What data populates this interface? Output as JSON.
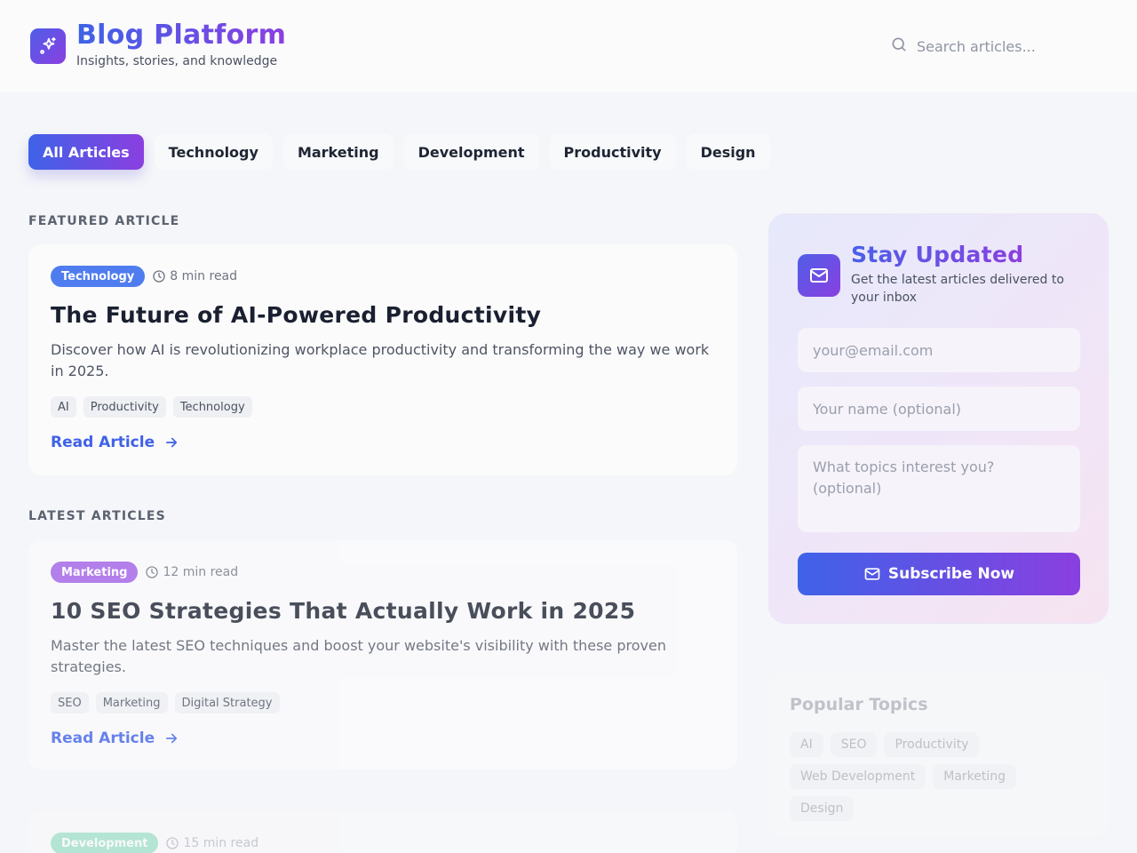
{
  "header": {
    "title": "Blog Platform",
    "subtitle": "Insights, stories, and knowledge",
    "search_placeholder": "Search articles...",
    "logo_icon": "sparkles-icon"
  },
  "tabs": [
    {
      "label": "All Articles",
      "active": true
    },
    {
      "label": "Technology",
      "active": false
    },
    {
      "label": "Marketing",
      "active": false
    },
    {
      "label": "Development",
      "active": false
    },
    {
      "label": "Productivity",
      "active": false
    },
    {
      "label": "Design",
      "active": false
    }
  ],
  "featured": {
    "section_label": "FEATURED ARTICLE",
    "category": "Technology",
    "category_color": "#4f7df0",
    "read_time": "8 min read",
    "title": "The Future of AI-Powered Productivity",
    "description": "Discover how AI is revolutionizing workplace productivity and transforming the way we work in 2025.",
    "tags": [
      "AI",
      "Productivity",
      "Technology"
    ],
    "link_label": "Read Article"
  },
  "latest": {
    "section_label": "LATEST ARTICLES",
    "articles": [
      {
        "category": "Marketing",
        "category_color": "#a15ee6",
        "read_time": "12 min read",
        "title": "10 SEO Strategies That Actually Work in 2025",
        "description": "Master the latest SEO techniques and boost your website's visibility with these proven strategies.",
        "tags": [
          "SEO",
          "Marketing",
          "Digital Strategy"
        ],
        "link_label": "Read Article"
      },
      {
        "category": "Development",
        "category_color": "#3dc48e",
        "read_time": "15 min read"
      }
    ]
  },
  "newsletter": {
    "title": "Stay Updated",
    "subtitle": "Get the latest articles delivered to your inbox",
    "email_placeholder": "your@email.com",
    "name_placeholder": "Your name (optional)",
    "topics_placeholder": "What topics interest you? (optional)",
    "button_label": "Subscribe Now",
    "icon": "mail-icon"
  },
  "popular_topics": {
    "title": "Popular Topics",
    "tags": [
      "AI",
      "SEO",
      "Productivity",
      "Web Development",
      "Marketing",
      "Design"
    ]
  },
  "colors": {
    "accent_start": "#3f62e8",
    "accent_end": "#8a3fe0",
    "link": "#3f62e6"
  }
}
